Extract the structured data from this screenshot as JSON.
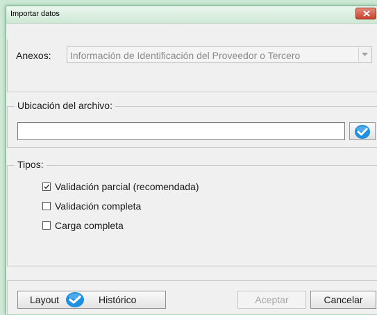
{
  "window": {
    "title": "Importar datos"
  },
  "anexos": {
    "label": "Anexos:",
    "selected": "Información de Identificación del Proveedor o Tercero"
  },
  "ubicacion": {
    "legend": "Ubicación del archivo:",
    "value": "",
    "browse_icon": "check-circle-icon"
  },
  "tipos": {
    "legend": "Tipos:",
    "options": [
      {
        "label": "Validación parcial (recomendada)",
        "checked": true
      },
      {
        "label": "Validación completa",
        "checked": false
      },
      {
        "label": "Carga completa",
        "checked": false
      }
    ]
  },
  "buttons": {
    "layout": "Layout",
    "historico": "Histórico",
    "aceptar": "Aceptar",
    "cancelar": "Cancelar"
  },
  "colors": {
    "accent_blue": "#1f8fe0",
    "close_red": "#c7442c",
    "window_glow": "#cfe9d6"
  }
}
